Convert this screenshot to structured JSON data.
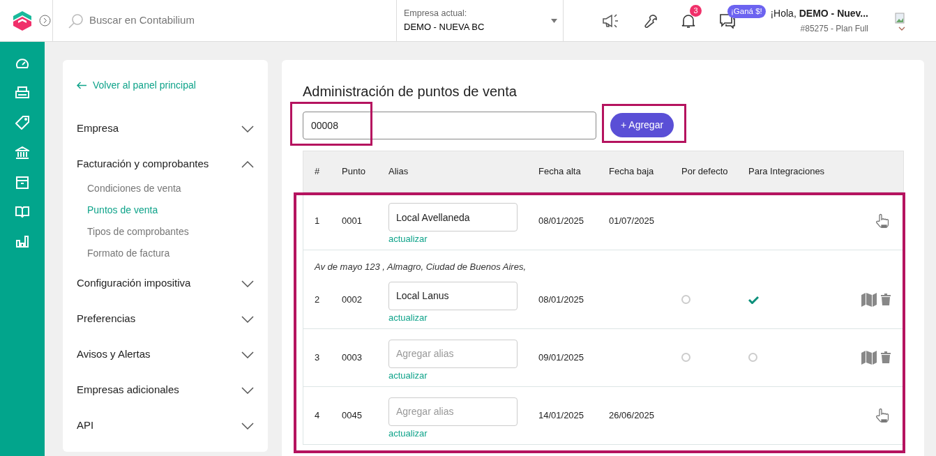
{
  "topbar": {
    "search_placeholder": "Buscar en Contabilium",
    "company_label": "Empresa actual:",
    "company_value": "DEMO - NUEVA BC",
    "notification_count": "3",
    "promo_badge": "¡Ganá $!",
    "greeting": "¡Hola, **DEMO - Nuev...**",
    "account": "#85275 - Plan Full"
  },
  "settings_nav": {
    "back_link": "Volver al panel principal",
    "sections": [
      {
        "label": "Empresa",
        "expanded": false
      },
      {
        "label": "Facturación y comprobantes",
        "expanded": true,
        "children": [
          {
            "label": "Condiciones de venta",
            "selected": false
          },
          {
            "label": "Puntos de venta",
            "selected": true
          },
          {
            "label": "Tipos de comprobantes",
            "selected": false
          },
          {
            "label": "Formato de factura",
            "selected": false
          }
        ]
      },
      {
        "label": "Configuración impositiva",
        "expanded": false
      },
      {
        "label": "Preferencias",
        "expanded": false
      },
      {
        "label": "Avisos y Alertas",
        "expanded": false
      },
      {
        "label": "Empresas adicionales",
        "expanded": false
      },
      {
        "label": "API",
        "expanded": false
      }
    ]
  },
  "main": {
    "title": "Administración de puntos de venta",
    "new_point_value": "00008",
    "add_button": "+ Agregar",
    "table": {
      "columns": [
        "#",
        "Punto",
        "Alias",
        "Fecha alta",
        "Fecha baja",
        "Por defecto",
        "Para Integraciones"
      ],
      "rows": [
        {
          "kind": "inactive",
          "number": "1",
          "point": "0001",
          "alias": "Local Avellaneda",
          "update_link": "actualizar",
          "date_from": "08/01/2025",
          "date_to": "01/07/2025"
        },
        {
          "kind": "active",
          "address": "Av de mayo 123 , Almagro, Ciudad de Buenos Aires,",
          "number": "2",
          "point": "0002",
          "alias": "Local Lanus",
          "update_link": "actualizar",
          "date_from": "08/01/2025",
          "default": false,
          "integration": true
        },
        {
          "kind": "active",
          "number": "3",
          "point": "0003",
          "alias_placeholder": "Agregar alias",
          "update_link": "actualizar",
          "date_from": "09/01/2025",
          "default": false,
          "integration": false
        },
        {
          "kind": "inactive",
          "number": "4",
          "point": "0045",
          "alias_placeholder": "Agregar alias",
          "update_link": "actualizar",
          "date_from": "14/01/2025",
          "date_to": "26/06/2025"
        }
      ]
    }
  }
}
